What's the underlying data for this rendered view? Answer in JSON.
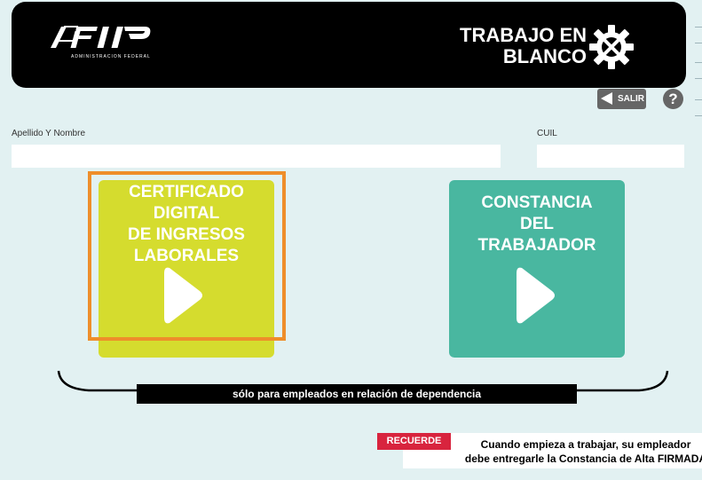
{
  "header": {
    "logo_text": "AFIP",
    "logo_subtitle": "ADMINISTRACION FEDERAL",
    "title_line1": "TRABAJO EN",
    "title_line2": "BLANCO"
  },
  "toolbar": {
    "salir_label": "SALIR",
    "help_label": "?"
  },
  "form": {
    "name_label": "Apellido Y Nombre",
    "name_value": "",
    "cuil_label": "CUIL",
    "cuil_value": ""
  },
  "cards": {
    "cert_lines": [
      "CERTIFICADO",
      "DIGITAL",
      "DE INGRESOS",
      "LABORALES"
    ],
    "const_lines": [
      "CONSTANCIA",
      "DEL",
      "TRABAJADOR"
    ]
  },
  "brace_label": "sólo para empleados en relación de dependencia",
  "notice": {
    "badge": "RECUERDE",
    "line1": "Cuando empieza a trabajar, su empleador",
    "line2": "debe entregarle la Constancia de Alta FIRMADA"
  },
  "colors": {
    "background": "#e2f1f2",
    "header": "#000000",
    "cert_card": "#d5dc2e",
    "const_card": "#49b7a0",
    "highlight": "#ee8e2a",
    "badge": "#d8243e"
  },
  "icons": {
    "logo": "afip-logo-icon",
    "gear": "gear-tools-icon",
    "back": "back-arrow-icon",
    "help": "help-icon",
    "play": "play-icon"
  }
}
